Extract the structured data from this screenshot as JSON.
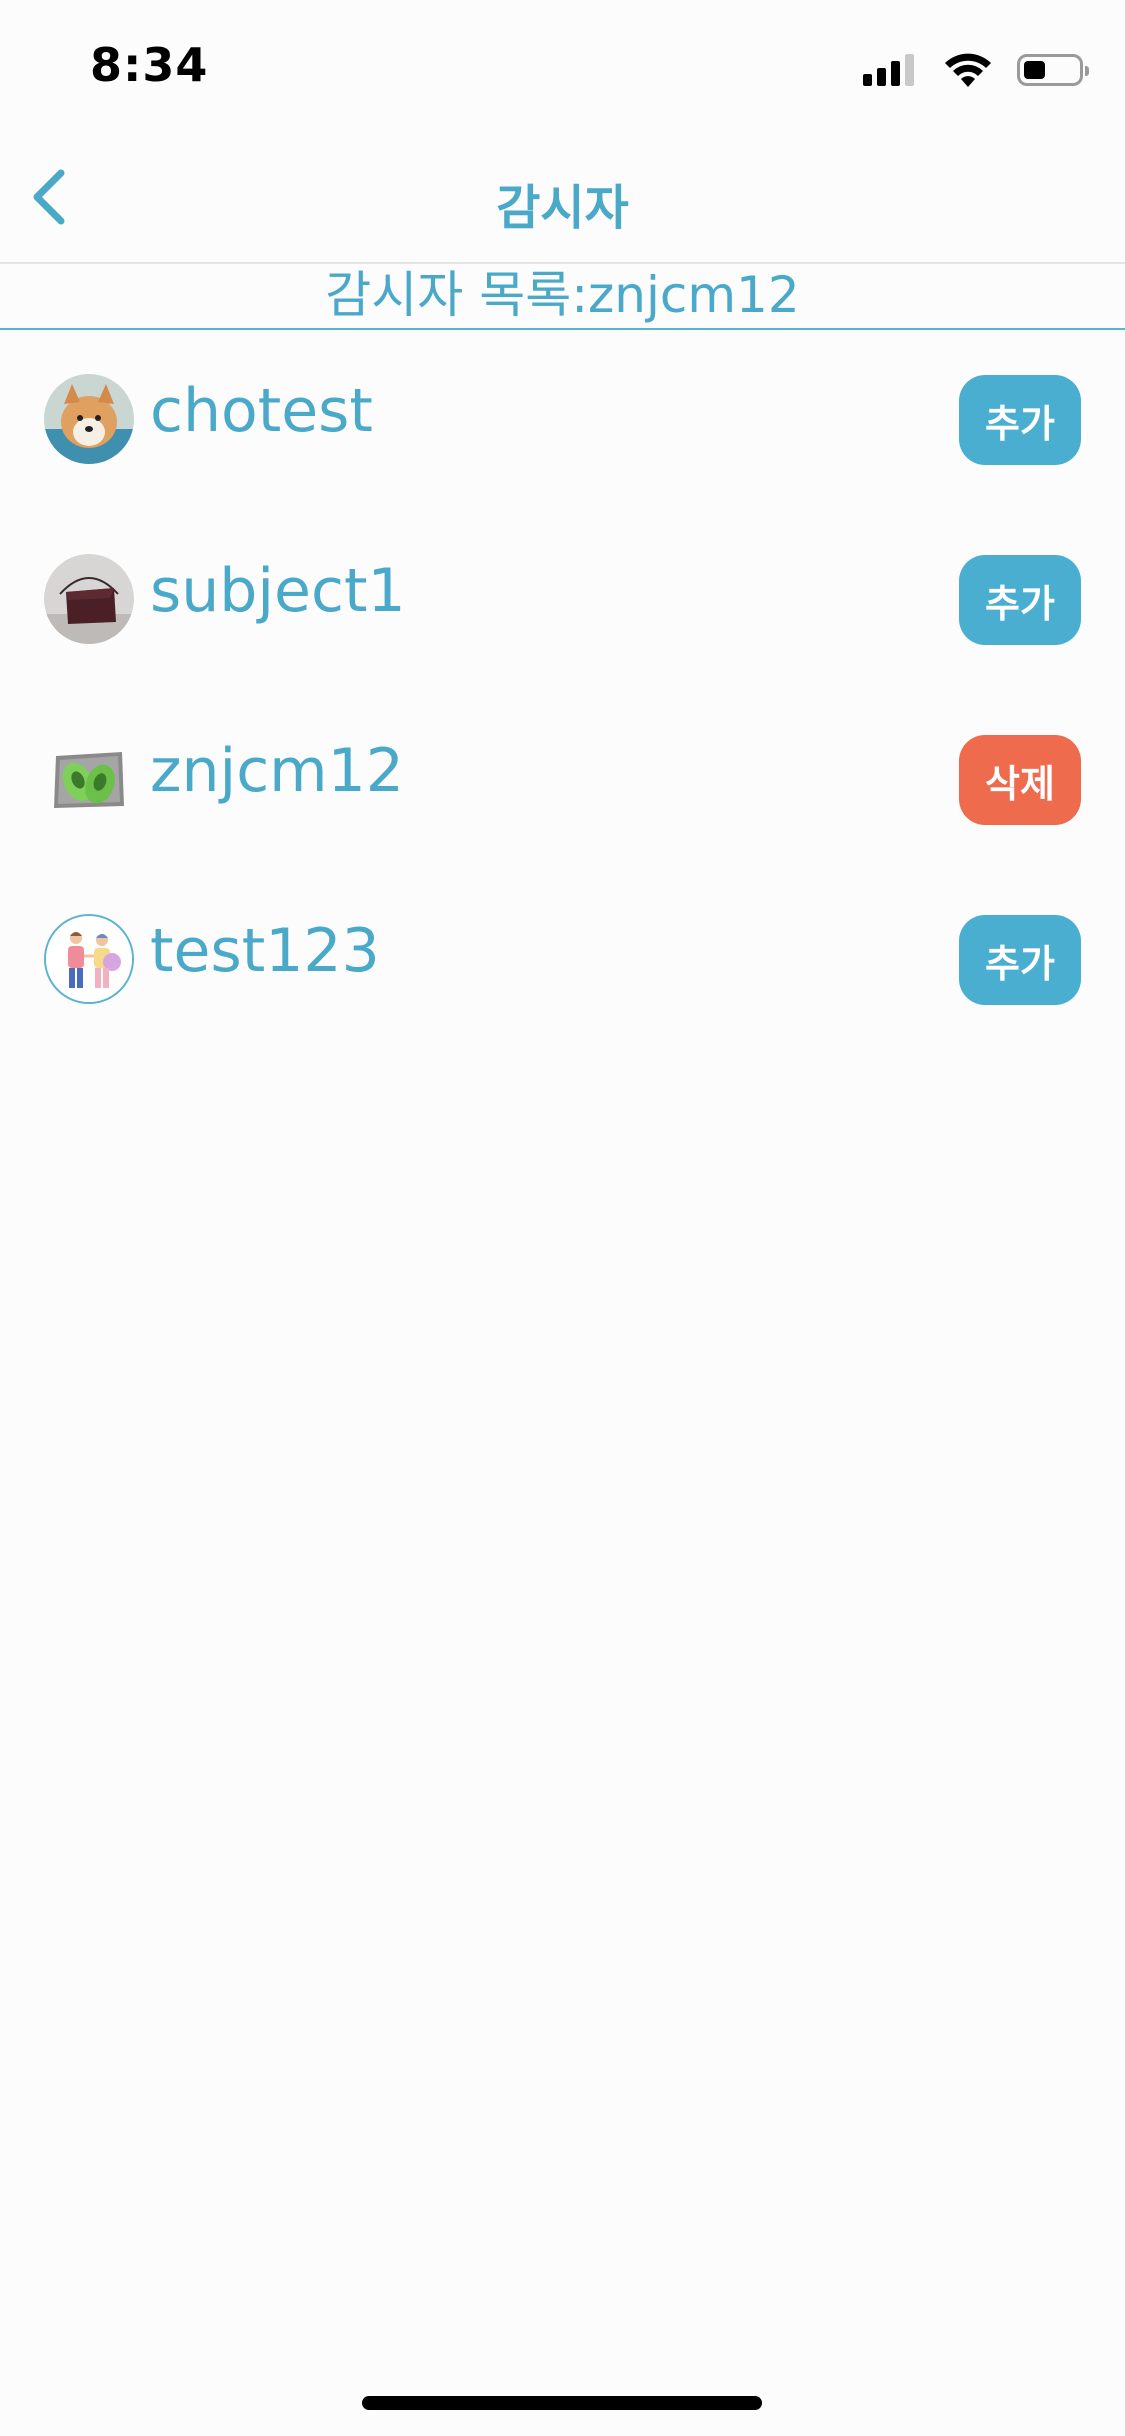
{
  "status_bar": {
    "time": "8:34",
    "battery_level": 0.4
  },
  "nav": {
    "title": "감시자",
    "back_icon": "chevron-left-icon"
  },
  "list_header": "감시자 목록:znjcm12",
  "colors": {
    "accent": "#4aa8c8",
    "add_button": "#4aaed0",
    "delete_button": "#ee6c4d",
    "background": "#fcfcfc"
  },
  "users": [
    {
      "name": "chotest",
      "avatar": "dog-photo-avatar",
      "action": "추가",
      "action_type": "add"
    },
    {
      "name": "subject1",
      "avatar": "bag-photo-avatar",
      "action": "추가",
      "action_type": "add"
    },
    {
      "name": "znjcm12",
      "avatar": "shoes-photo-avatar",
      "action": "삭제",
      "action_type": "delete"
    },
    {
      "name": "test123",
      "avatar": "illustration-avatar",
      "action": "추가",
      "action_type": "add"
    }
  ]
}
